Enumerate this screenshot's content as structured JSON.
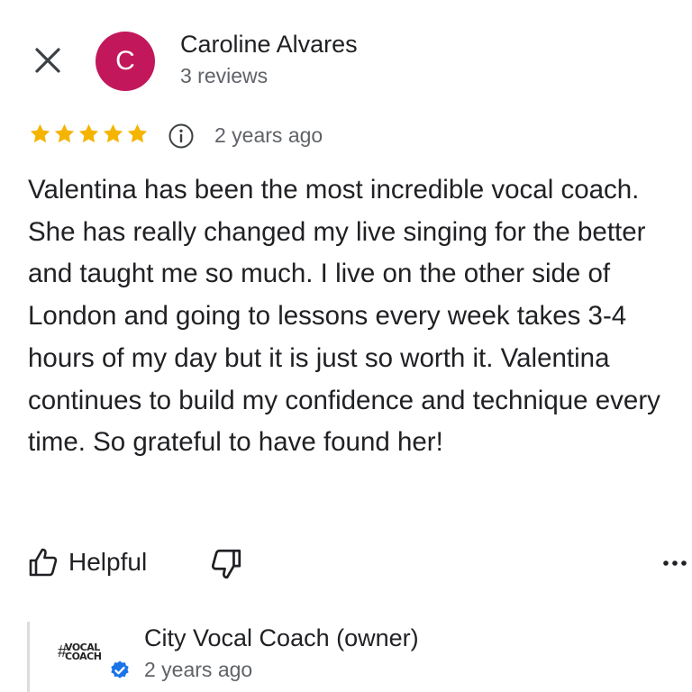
{
  "review": {
    "reviewer_name": "Caroline Alvares",
    "reviewer_initial": "C",
    "review_count": "3 reviews",
    "rating": 5,
    "time_ago": "2 years ago",
    "text": "Valentina has been the most incredible vocal coach. She has really changed my live singing for the better and taught me so much. I live on the other side of London and going to lessons every week takes 3-4 hours of my day but it is just so worth it. Valentina continues to build my confidence and technique every time. So grateful to have found her!"
  },
  "actions": {
    "helpful_label": "Helpful"
  },
  "owner_reply": {
    "name": "City Vocal Coach (owner)",
    "time_ago": "2 years ago",
    "logo_text_line1": "VOCAL",
    "logo_text_line2": "COACH"
  },
  "colors": {
    "avatar": "#c2185b",
    "star": "#f4b400",
    "verified": "#1a73e8"
  },
  "icons": {
    "close": "close-icon",
    "star": "star-icon",
    "info": "info-icon",
    "thumbs_up": "thumbs-up-icon",
    "thumbs_down": "thumbs-down-icon",
    "more": "more-horizontal-icon",
    "verified": "verified-check-icon"
  }
}
